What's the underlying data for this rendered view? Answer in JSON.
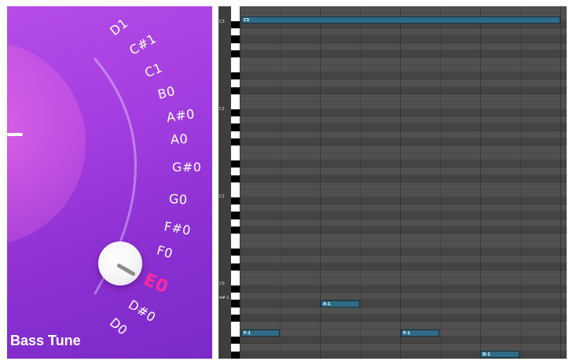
{
  "tune_panel": {
    "title": "Bass Tune",
    "notes": [
      "D1",
      "C#1",
      "C1",
      "B0",
      "A#0",
      "A0",
      "G#0",
      "G0",
      "F#0",
      "F0",
      "E0",
      "D#0",
      "D0"
    ],
    "selected_note": "E0",
    "knob_icon": "rotary-knob-icon",
    "colors": {
      "accent": "#ff2aa2",
      "background": "#9a38da"
    }
  },
  "piano_roll": {
    "octave_labels": [
      "C3",
      "C2",
      "C1",
      "C0",
      "A#-1"
    ],
    "notes": [
      {
        "label": "C3"
      },
      {
        "label": "A-1"
      },
      {
        "label": "F-1"
      },
      {
        "label": "F-1"
      },
      {
        "label": "D-1"
      }
    ],
    "colors": {
      "note_fill": "#2f6a87",
      "grid_background": "#4a4a4a"
    }
  }
}
